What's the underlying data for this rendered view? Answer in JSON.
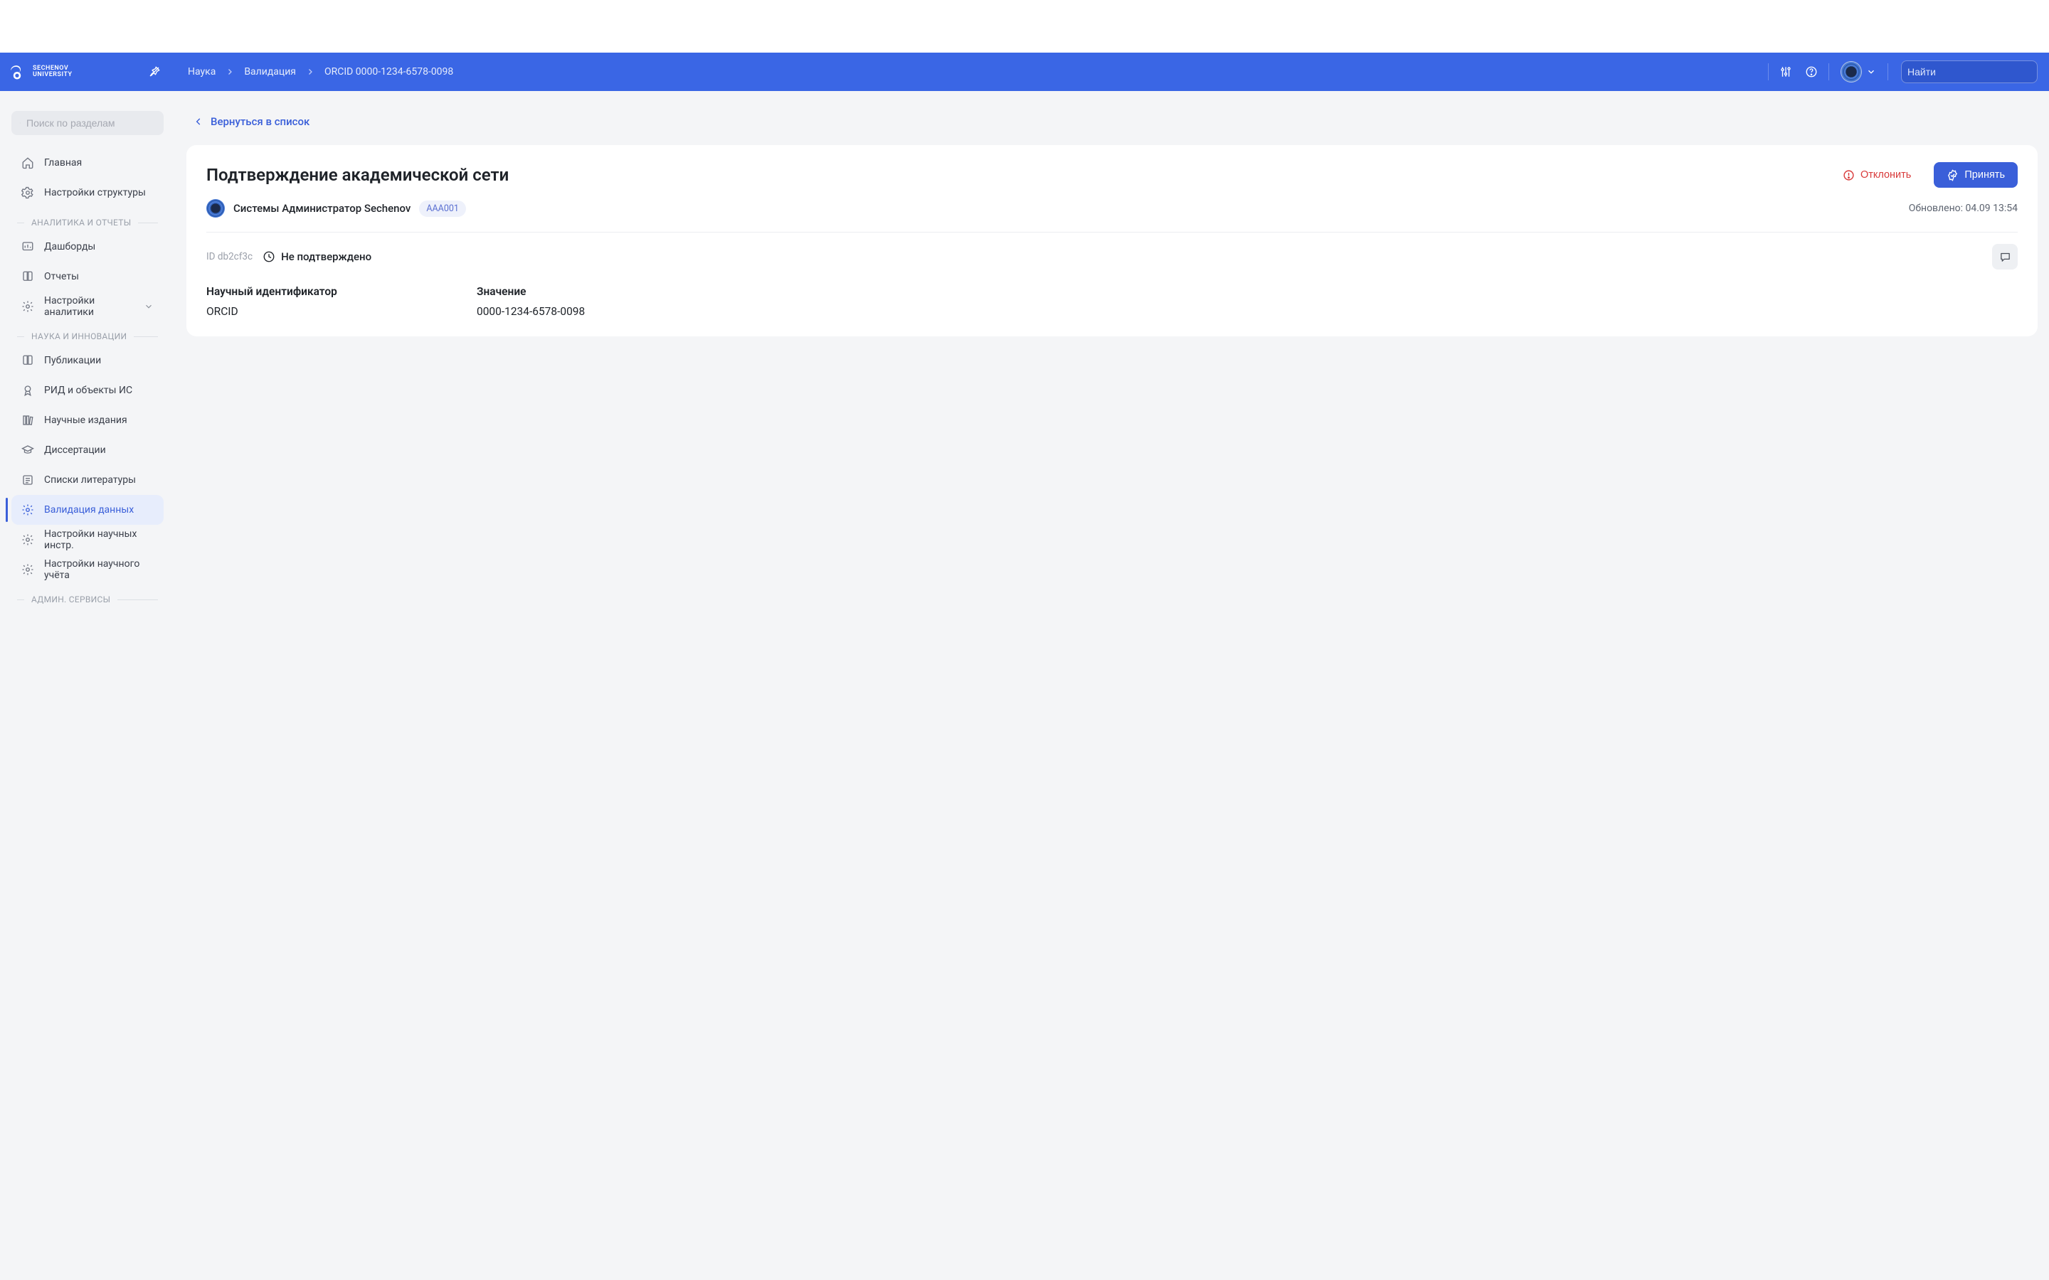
{
  "brand": {
    "line1": "Sechenov",
    "line2": "University"
  },
  "breadcrumbs": [
    "Наука",
    "Валидация",
    "ORCID 0000-1234-6578-0098"
  ],
  "topSearch": {
    "placeholder": "Найти"
  },
  "sidebar": {
    "searchPlaceholder": "Поиск по разделам",
    "topItems": [
      {
        "label": "Главная",
        "icon": "home"
      },
      {
        "label": "Настройки структуры",
        "icon": "gear"
      }
    ],
    "sections": [
      {
        "title": "АНАЛИТИКА И ОТЧЕТЫ",
        "items": [
          {
            "label": "Дашборды",
            "icon": "dashboard"
          },
          {
            "label": "Отчеты",
            "icon": "book"
          },
          {
            "label": "Настройки аналитики",
            "icon": "gear",
            "hasChevron": true
          }
        ]
      },
      {
        "title": "НАУКА И ИННОВАЦИИ",
        "items": [
          {
            "label": "Публикации",
            "icon": "book"
          },
          {
            "label": "РИД и объекты ИС",
            "icon": "award"
          },
          {
            "label": "Научные издания",
            "icon": "books"
          },
          {
            "label": "Диссертации",
            "icon": "cap"
          },
          {
            "label": "Списки литературы",
            "icon": "list"
          },
          {
            "label": "Валидация данных",
            "icon": "gear",
            "active": true
          },
          {
            "label": "Настройки научных инстр.",
            "icon": "gear"
          },
          {
            "label": "Настройки научного учёта",
            "icon": "gear"
          }
        ]
      },
      {
        "title": "АДМИН. СЕРВИСЫ",
        "items": []
      }
    ]
  },
  "main": {
    "backLabel": "Вернуться в список",
    "title": "Подтверждение академической сети",
    "rejectLabel": "Отклонить",
    "acceptLabel": "Принять",
    "userName": "Системы Администратор Sechenov",
    "userIdPill": "AAA001",
    "updatedLabel": "Обновлено: 04.09 13:54",
    "recordId": "ID db2cf3c",
    "statusText": "Не подтверждено",
    "identifierLabel": "Научный идентификатор",
    "identifierValue": "ORCID",
    "valueLabel": "Значение",
    "valueValue": "0000-1234-6578-0098"
  },
  "colors": {
    "accent": "#3a5fd9",
    "danger": "#d83a3a"
  }
}
